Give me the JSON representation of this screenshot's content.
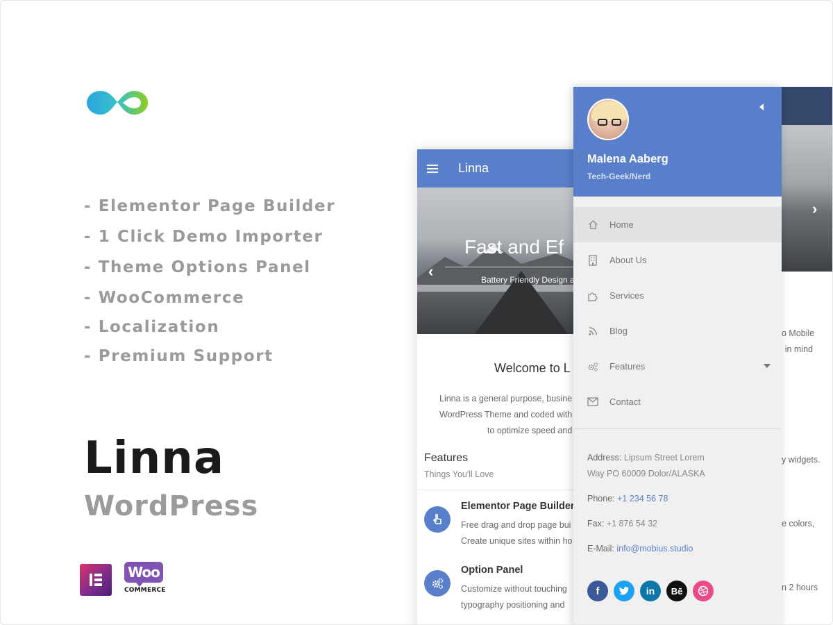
{
  "features_list": [
    "- Elementor Page Builder",
    "- 1 Click Demo Importer",
    "- Theme Options Panel",
    "- WooCommerce",
    "- Localization",
    "- Premium Support"
  ],
  "brand": {
    "title": "Linna",
    "subtitle": "WordPress"
  },
  "badges": {
    "woo_top": "Woo",
    "woo_bottom": "COMMERCE"
  },
  "phone_left": {
    "app_title": "Linna",
    "hero_title": "Fast and Ef",
    "hero_sub": "Battery Friendly Design a",
    "welcome": "Welcome to L",
    "desc": [
      "Linna is a general purpose, busine",
      "WordPress Theme and coded with",
      "to optimize speed and"
    ],
    "features_title": "Features",
    "features_sub": "Things You'll Love",
    "items": [
      {
        "title": "Elementor Page Builder",
        "lines": [
          "Free drag and drop page bui",
          "Create unique sites within ho"
        ],
        "icon": "hand-pointer-icon"
      },
      {
        "title": "Option Panel",
        "lines": [
          "Customize without touching",
          "typography positioning and"
        ],
        "icon": "cogs-icon"
      }
    ]
  },
  "phone_right": {
    "texts": [
      {
        "text": "o Mobile"
      },
      {
        "text": "in mind"
      },
      {
        "text": "y widgets."
      },
      {
        "text": "e colors,"
      },
      {
        "text": "n 2 hours"
      }
    ]
  },
  "drawer": {
    "name": "Malena Aaberg",
    "role": "Tech-Geek/Nerd",
    "menu": [
      {
        "label": "Home",
        "icon": "home-icon",
        "active": true
      },
      {
        "label": "About Us",
        "icon": "building-icon"
      },
      {
        "label": "Services",
        "icon": "puzzle-icon"
      },
      {
        "label": "Blog",
        "icon": "rss-icon"
      },
      {
        "label": "Features",
        "icon": "gears-icon",
        "has_submenu": true
      },
      {
        "label": "Contact",
        "icon": "envelope-icon"
      }
    ],
    "address_label": "Address:",
    "address_line1": "Lipsum Street Lorem",
    "address_line2": "Way PO 60009 Dolor/ALASKA",
    "phone_label": "Phone:",
    "phone_value": "+1 234 56 78",
    "fax_label": "Fax:",
    "fax_value": "+1 876 54 32",
    "email_label": "E-Mail:",
    "email_value": "info@mobius.studio",
    "social": [
      {
        "name": "facebook",
        "glyph": "f",
        "color": "#3b5998"
      },
      {
        "name": "twitter",
        "glyph": "t",
        "color": "#1da1f2"
      },
      {
        "name": "linkedin",
        "glyph": "in",
        "color": "#0e76a8"
      },
      {
        "name": "behance",
        "glyph": "Bē",
        "color": "#111111"
      },
      {
        "name": "dribbble",
        "glyph": "◎",
        "color": "#ea4c89"
      }
    ]
  },
  "colors": {
    "accent": "#5a7fca",
    "dark_bar": "#33486a",
    "muted_text": "#9a9a9a"
  }
}
